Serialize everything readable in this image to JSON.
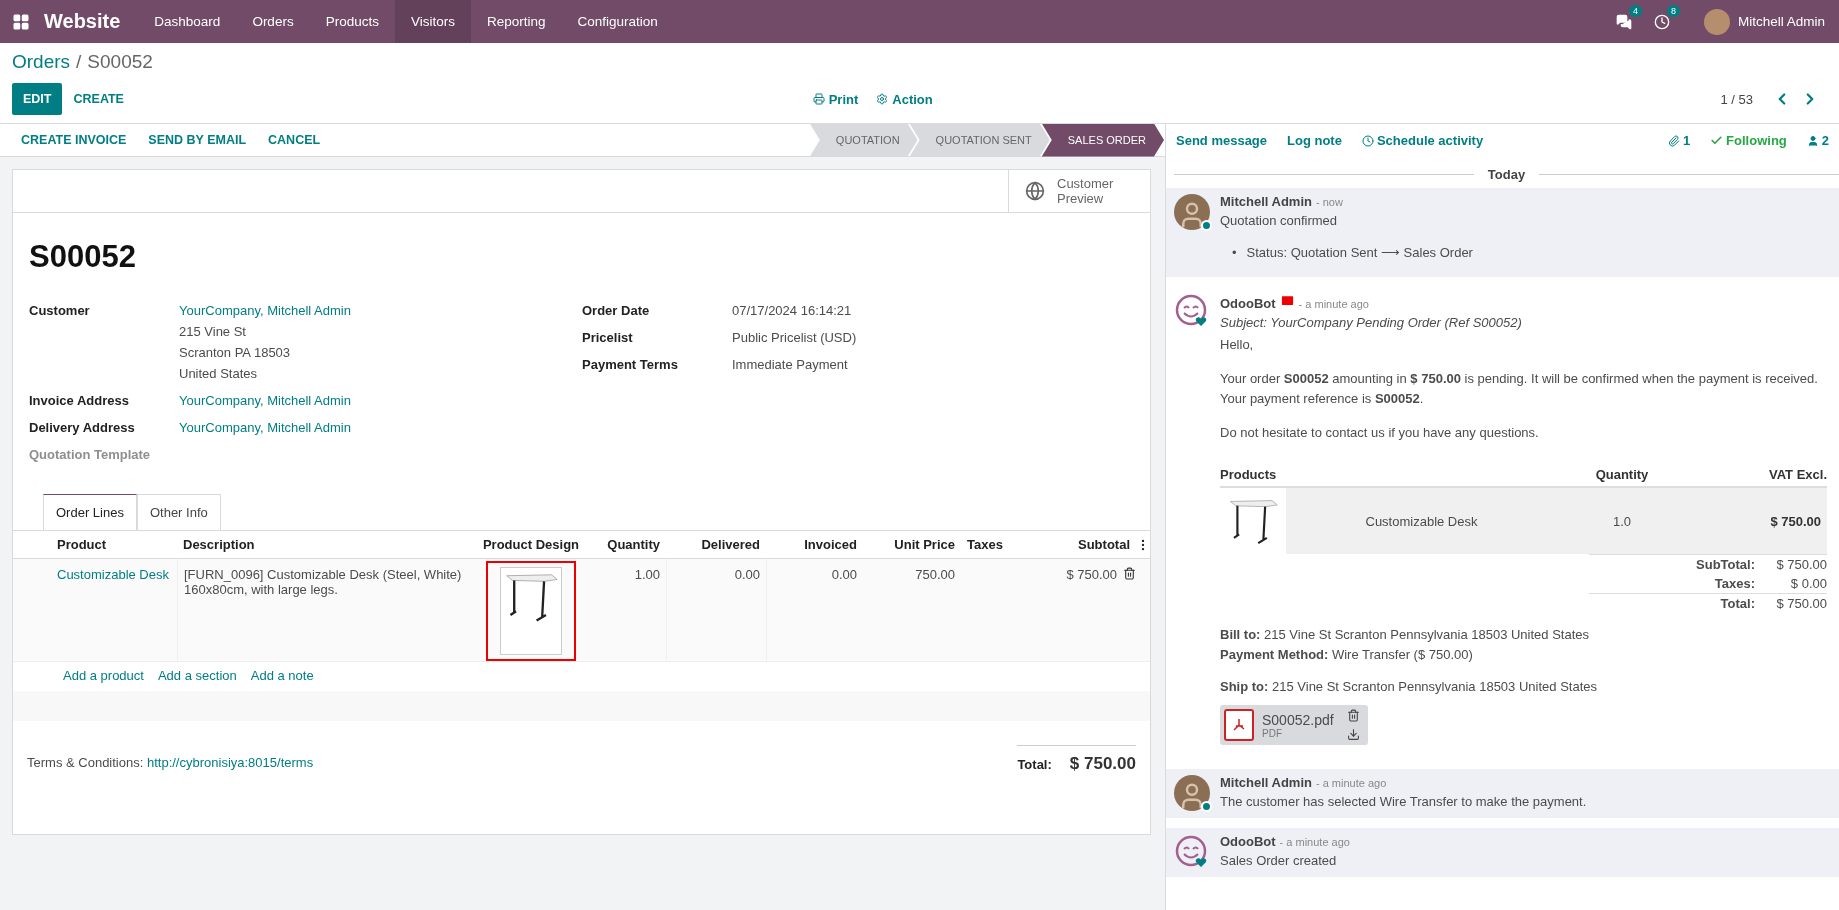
{
  "topbar": {
    "app": "Website",
    "menu": [
      {
        "label": "Dashboard",
        "selected": false
      },
      {
        "label": "Orders",
        "selected": false
      },
      {
        "label": "Products",
        "selected": false
      },
      {
        "label": "Visitors",
        "selected": true
      },
      {
        "label": "Reporting",
        "selected": false
      },
      {
        "label": "Configuration",
        "selected": false
      }
    ],
    "messages_badge": "4",
    "activities_badge": "8",
    "user": "Mitchell Admin"
  },
  "breadcrumb": {
    "parent": "Orders",
    "separator": "/",
    "current": "S00052"
  },
  "control_panel": {
    "buttons": [
      {
        "label": "EDIT",
        "primary": true
      },
      {
        "label": "CREATE",
        "primary": false
      }
    ],
    "print": "Print",
    "action": "Action",
    "pager": "1 / 53"
  },
  "status_bar": {
    "actions": [
      "CREATE INVOICE",
      "SEND BY EMAIL",
      "CANCEL"
    ],
    "stages": [
      {
        "label": "QUOTATION",
        "selected": false
      },
      {
        "label": "QUOTATION SENT",
        "selected": false
      },
      {
        "label": "SALES ORDER",
        "selected": true
      }
    ]
  },
  "sheet": {
    "preview_button": [
      "Customer",
      "Preview"
    ],
    "title": "S00052",
    "left_fields": [
      {
        "label": "Customer",
        "value": "YourCompany, Mitchell Admin",
        "link": true,
        "extra": [
          "215 Vine St",
          "Scranton PA 18503",
          "United States"
        ],
        "muted": false
      },
      {
        "label": "Invoice Address",
        "value": "YourCompany, Mitchell Admin",
        "link": true,
        "muted": false
      },
      {
        "label": "Delivery Address",
        "value": "YourCompany, Mitchell Admin",
        "link": true,
        "muted": false
      },
      {
        "label": "Quotation Template",
        "muted": true
      }
    ],
    "right_fields": [
      {
        "label": "Order Date",
        "value": "07/17/2024 16:14:21"
      },
      {
        "label": "Pricelist",
        "value": "Public Pricelist (USD)"
      },
      {
        "label": "Payment Terms",
        "value": "Immediate Payment"
      }
    ],
    "tabs": [
      {
        "label": "Order Lines",
        "selected": true
      },
      {
        "label": "Other Info",
        "selected": false
      }
    ],
    "table": {
      "columns": [
        "Product",
        "Description",
        "Product Design",
        "Quantity",
        "Delivered",
        "Invoiced",
        "Unit Price",
        "Taxes",
        "Subtotal"
      ],
      "rows": [
        {
          "product": "Customizable Desk",
          "description": "[FURN_0096] Customizable Desk (Steel, White) 160x80cm, with large legs.",
          "design_highlighted": true,
          "quantity": "1.00",
          "delivered": "0.00",
          "invoiced": "0.00",
          "unit_price": "750.00",
          "subtotal": "$ 750.00"
        }
      ],
      "add_links": [
        "Add a product",
        "Add a section",
        "Add a note"
      ]
    },
    "terms_label": "Terms & Conditions:",
    "terms_link": "http://cybronisiya:8015/terms",
    "total_label": "Total:",
    "total": "$ 750.00"
  },
  "chatter": {
    "actions": [
      "Send message",
      "Log note",
      "Schedule activity"
    ],
    "attachments": "1",
    "following": "Following",
    "followers": "2",
    "divider": "Today",
    "messages": [
      {
        "kind": "note",
        "avatar": {
          "kind": "user"
        },
        "highlighted": true,
        "author": "Mitchell Admin",
        "time": "- now",
        "body": "Quotation confirmed",
        "tracking": {
          "marker": "•",
          "text": "Status: Quotation Sent ⟶ Sales Order"
        }
      },
      {
        "kind": "email",
        "avatar": {
          "kind": "bot"
        },
        "highlighted": false,
        "author": "OdooBot",
        "time": "- a minute ago",
        "subject": "Subject: YourCompany Pending Order (Ref S00052)",
        "paragraphs": [
          "Hello,",
          "Your order **S00052** amounting in **$ 750.00** is pending. It will be confirmed when the payment is received. Your payment reference is **S00052**.",
          "Do not hesitate to contact us if you have any questions."
        ],
        "products": {
          "columns": [
            "Products",
            "Quantity",
            "VAT Excl."
          ],
          "rows": [
            {
              "name": "Customizable Desk",
              "quantity": "1.0",
              "amount": "$ 750.00"
            }
          ],
          "totals": [
            {
              "label": "SubTotal:",
              "value": "$ 750.00"
            },
            {
              "label": "Taxes:",
              "value": "$ 0.00"
            },
            {
              "label": "Total:",
              "value": "$ 750.00"
            }
          ]
        },
        "addresses": [
          [
            "**Bill to:** 215 Vine St Scranton Pennsylvania 18503 United States",
            "**Payment Method:** Wire Transfer ($ 750.00)"
          ],
          [
            "**Ship to:** 215 Vine St Scranton Pennsylvania 18503 United States"
          ]
        ],
        "attachment": {
          "name": "S00052.pdf",
          "type": "PDF"
        }
      },
      {
        "kind": "simple",
        "avatar": {
          "kind": "user"
        },
        "highlighted": true,
        "author": "Mitchell Admin",
        "time": "- a minute ago",
        "body": "The customer has selected Wire Transfer to make the payment."
      },
      {
        "kind": "simple",
        "avatar": {
          "kind": "bot"
        },
        "highlighted": true,
        "author": "OdooBot",
        "time": "- a minute ago",
        "body": "Sales Order created"
      }
    ]
  }
}
